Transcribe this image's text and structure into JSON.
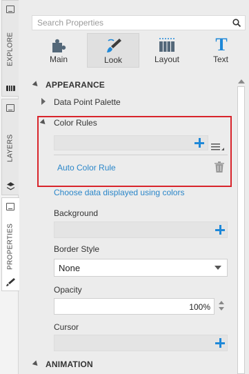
{
  "side_tabs": [
    {
      "label": "EXPLORE"
    },
    {
      "label": "LAYERS"
    },
    {
      "label": "PROPERTIES"
    }
  ],
  "search": {
    "placeholder": "Search Properties"
  },
  "toolbar": {
    "buttons": [
      {
        "label": "Main",
        "icon": "puzzle-icon"
      },
      {
        "label": "Look",
        "icon": "brush-icon"
      },
      {
        "label": "Layout",
        "icon": "layout-icon"
      },
      {
        "label": "Text",
        "icon": "text-icon",
        "glyph": "T"
      }
    ],
    "active": "Look"
  },
  "appearance": {
    "heading": "APPEARANCE",
    "data_point_palette": "Data Point Palette",
    "color_rules": "Color Rules",
    "auto_color_rule": "Auto Color Rule",
    "choose_link": "Choose data displayed using colors",
    "background_label": "Background",
    "border_style_label": "Border Style",
    "border_style_value": "None",
    "opacity_label": "Opacity",
    "opacity_value": "100%",
    "cursor_label": "Cursor"
  },
  "animation": {
    "heading": "ANIMATION"
  },
  "colors": {
    "accent_blue": "#1e88d8",
    "highlight_red": "#d8232a",
    "link_blue": "#2a86c9"
  }
}
